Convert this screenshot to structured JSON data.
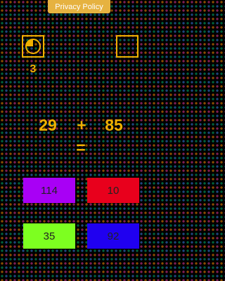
{
  "privacy_label": "Privacy Policy",
  "timer": {
    "icon": "timer-icon",
    "count": "3"
  },
  "score_box": {
    "icon": "empty-square"
  },
  "equation": {
    "a": "29",
    "operator": "+",
    "b": "85",
    "equals": "="
  },
  "answers": [
    {
      "label": "114",
      "color": "#a800f5"
    },
    {
      "label": "10",
      "color": "#e8001c"
    },
    {
      "label": "35",
      "color": "#7dff20"
    },
    {
      "label": "92",
      "color": "#2000f0"
    }
  ],
  "colors": {
    "accent": "#f0b000",
    "privacy_bg": "#e6b240",
    "background": "#000000"
  }
}
